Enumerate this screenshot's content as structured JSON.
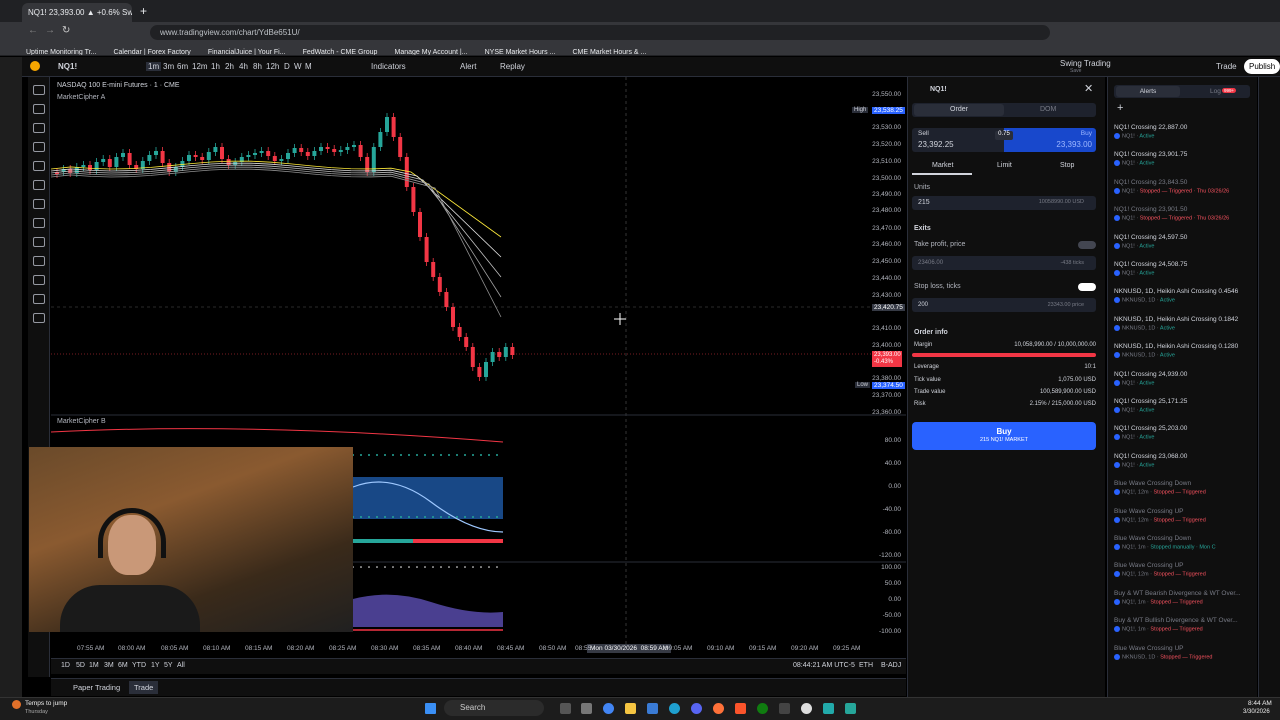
{
  "browser": {
    "tab_title": "NQ1! 23,393.00 ▲ +0.6% Swin",
    "url": "www.tradingview.com/chart/YdBe651U/",
    "bookmarks": [
      "Uptime Monitoring Tr...",
      "Calendar | Forex Factory",
      "FinancialJuice | Your Fi...",
      "FedWatch - CME Group",
      "Manage My Account |...",
      "NYSE Market Hours ...",
      "CME Market Hours & ..."
    ]
  },
  "toolbar": {
    "symbol": "NQ1!",
    "intervals": [
      "1m",
      "3m",
      "6m",
      "12m",
      "1h",
      "2h",
      "4h",
      "8h",
      "12h",
      "D",
      "W",
      "M"
    ],
    "indicators_label": "Indicators",
    "alert_label": "Alert",
    "replay_label": "Replay",
    "layout_name": "Swing Trading",
    "layout_sub": "Save",
    "trade_label": "Trade",
    "publish_label": "Publish"
  },
  "chart": {
    "title": "NASDAQ 100 E-mini Futures · 1 · CME",
    "indicator_a": "MarketCipher A",
    "indicator_b": "MarketCipher B",
    "high_label": "High",
    "high_price": "23,538.25",
    "low_label": "Low",
    "low_price": "23,374.50",
    "current_price": "23,393.00",
    "current_change": "-0.43%",
    "crosshair_price": "23,420.75",
    "crosshair_time": "Mon 03/30/2026  08:59 AM",
    "y_ticks": [
      "23,550.00",
      "23,530.00",
      "23,520.00",
      "23,510.00",
      "23,500.00",
      "23,490.00",
      "23,480.00",
      "23,470.00",
      "23,460.00",
      "23,450.00",
      "23,440.00",
      "23,430.00",
      "23,410.00",
      "23,400.00",
      "23,380.00",
      "23,370.00",
      "23,360.00"
    ],
    "osc_ticks_top": [
      "80.00",
      "40.00",
      "0.00",
      "-40.00",
      "-80.00",
      "-120.00"
    ],
    "osc_ticks_bottom": [
      "100.00",
      "50.00",
      "0.00",
      "-50.00",
      "-100.00"
    ],
    "x_ticks": [
      "07:55 AM",
      "08:00 AM",
      "08:05 AM",
      "08:10 AM",
      "08:15 AM",
      "08:20 AM",
      "08:25 AM",
      "08:30 AM",
      "08:35 AM",
      "08:40 AM",
      "08:45 AM",
      "08:50 AM",
      "08:55",
      "09:05 AM",
      "09:10 AM",
      "09:15 AM",
      "09:20 AM",
      "09:25 AM"
    ],
    "ranges": [
      "1D",
      "5D",
      "1M",
      "3M",
      "6M",
      "YTD",
      "1Y",
      "5Y",
      "All"
    ],
    "clock": "08:44:21 AM UTC-5",
    "session": "ETH",
    "adj": "B-ADJ"
  },
  "bottom_tabs": [
    "Paper Trading",
    "Trade"
  ],
  "order": {
    "symbol": "NQ1!",
    "tabs": [
      "Order",
      "DOM"
    ],
    "sell_label": "Sell",
    "sell_price": "23,392.25",
    "spread": "0.75",
    "buy_label": "Buy",
    "buy_price": "23,393.00",
    "order_types": [
      "Market",
      "Limit",
      "Stop"
    ],
    "units_label": "Units",
    "units_value": "215",
    "units_usd": "10058990.00 USD",
    "exits_label": "Exits",
    "take_profit_label": "Take profit, price",
    "take_profit_value": "23406.00",
    "take_profit_ticks": "-438 ticks",
    "stop_loss_label": "Stop loss, ticks",
    "stop_loss_value": "200",
    "stop_loss_price": "23343.00 price",
    "order_info_label": "Order info",
    "margin_label": "Margin",
    "margin_value": "10,058,990.00 / 10,000,000.00",
    "leverage_label": "Leverage",
    "leverage_value": "10:1",
    "tick_value_label": "Tick value",
    "tick_value_value": "1,075.00 USD",
    "trade_value_label": "Trade value",
    "trade_value_value": "100,589,900.00 USD",
    "risk_label": "Risk",
    "risk_value": "2.15% / 215,000.00 USD",
    "buy_button": "Buy",
    "buy_button_sub": "215 NQ1! MARKET"
  },
  "alerts_panel": {
    "tab_alerts": "Alerts",
    "tab_log": "Log",
    "log_badge": "999+",
    "items": [
      {
        "title": "NQ1! Crossing 22,887.00",
        "sub": "NQ1!",
        "status": "Active",
        "dim": false,
        "triggered": false
      },
      {
        "title": "NQ1! Crossing 23,901.75",
        "sub": "NQ1!",
        "status": "Active",
        "dim": false,
        "triggered": false
      },
      {
        "title": "NQ1! Crossing 23,843.50",
        "sub": "NQ1!",
        "status": "Stopped — Triggered · Thu 03/26/26",
        "dim": true,
        "triggered": true
      },
      {
        "title": "NQ1! Crossing 23,901.50",
        "sub": "NQ1!",
        "status": "Stopped — Triggered · Thu 03/26/26",
        "dim": true,
        "triggered": true
      },
      {
        "title": "NQ1! Crossing 24,597.50",
        "sub": "NQ1!",
        "status": "Active",
        "dim": false,
        "triggered": false
      },
      {
        "title": "NQ1! Crossing 24,508.75",
        "sub": "NQ1!",
        "status": "Active",
        "dim": false,
        "triggered": false
      },
      {
        "title": "NKNUSD, 1D, Heikin Ashi Crossing 0.4546",
        "sub": "NKNUSD, 1D",
        "status": "Active",
        "dim": false,
        "triggered": false
      },
      {
        "title": "NKNUSD, 1D, Heikin Ashi Crossing 0.1842",
        "sub": "NKNUSD, 1D",
        "status": "Active",
        "dim": false,
        "triggered": false
      },
      {
        "title": "NKNUSD, 1D, Heikin Ashi Crossing 0.1280",
        "sub": "NKNUSD, 1D",
        "status": "Active",
        "dim": false,
        "triggered": false
      },
      {
        "title": "NQ1! Crossing 24,939.00",
        "sub": "NQ1!",
        "status": "Active",
        "dim": false,
        "triggered": false
      },
      {
        "title": "NQ1! Crossing 25,171.25",
        "sub": "NQ1!",
        "status": "Active",
        "dim": false,
        "triggered": false
      },
      {
        "title": "NQ1! Crossing 25,203.00",
        "sub": "NQ1!",
        "status": "Active",
        "dim": false,
        "triggered": false
      },
      {
        "title": "NQ1! Crossing 23,068.00",
        "sub": "NQ1!",
        "status": "Active",
        "dim": false,
        "triggered": false
      },
      {
        "title": "Blue Wave Crossing Down",
        "sub": "NQ1!, 12m",
        "status": "Stopped — Triggered",
        "dim": true,
        "triggered": true
      },
      {
        "title": "Blue Wave Crossing UP",
        "sub": "NQ1!, 12m",
        "status": "Stopped — Triggered",
        "dim": true,
        "triggered": true
      },
      {
        "title": "Blue Wave Crossing Down",
        "sub": "NQ1!, 1m",
        "status": "Stopped manually · Mon C",
        "dim": true,
        "triggered": false
      },
      {
        "title": "Blue Wave Crossing UP",
        "sub": "NQ1!, 12m",
        "status": "Stopped — Triggered",
        "dim": true,
        "triggered": true
      },
      {
        "title": "Buy & WT Bearish Divergence & WT Over...",
        "sub": "NQ1!, 1m",
        "status": "Stopped — Triggered",
        "dim": true,
        "triggered": true
      },
      {
        "title": "Buy & WT Bullish Divergence & WT Over...",
        "sub": "NQ1!, 1m",
        "status": "Stopped — Triggered",
        "dim": true,
        "triggered": true
      },
      {
        "title": "Blue Wave Crossing UP",
        "sub": "NKNUSD, 1D",
        "status": "Stopped — Triggered",
        "dim": true,
        "triggered": true
      }
    ]
  },
  "taskbar": {
    "weather": "Temps to jump",
    "weather_sub": "Thursday",
    "search_placeholder": "Search",
    "time": "8:44 AM",
    "date": "3/30/2026"
  },
  "colors": {
    "up": "#26a69a",
    "down": "#f23645",
    "accent": "#2962ff"
  }
}
